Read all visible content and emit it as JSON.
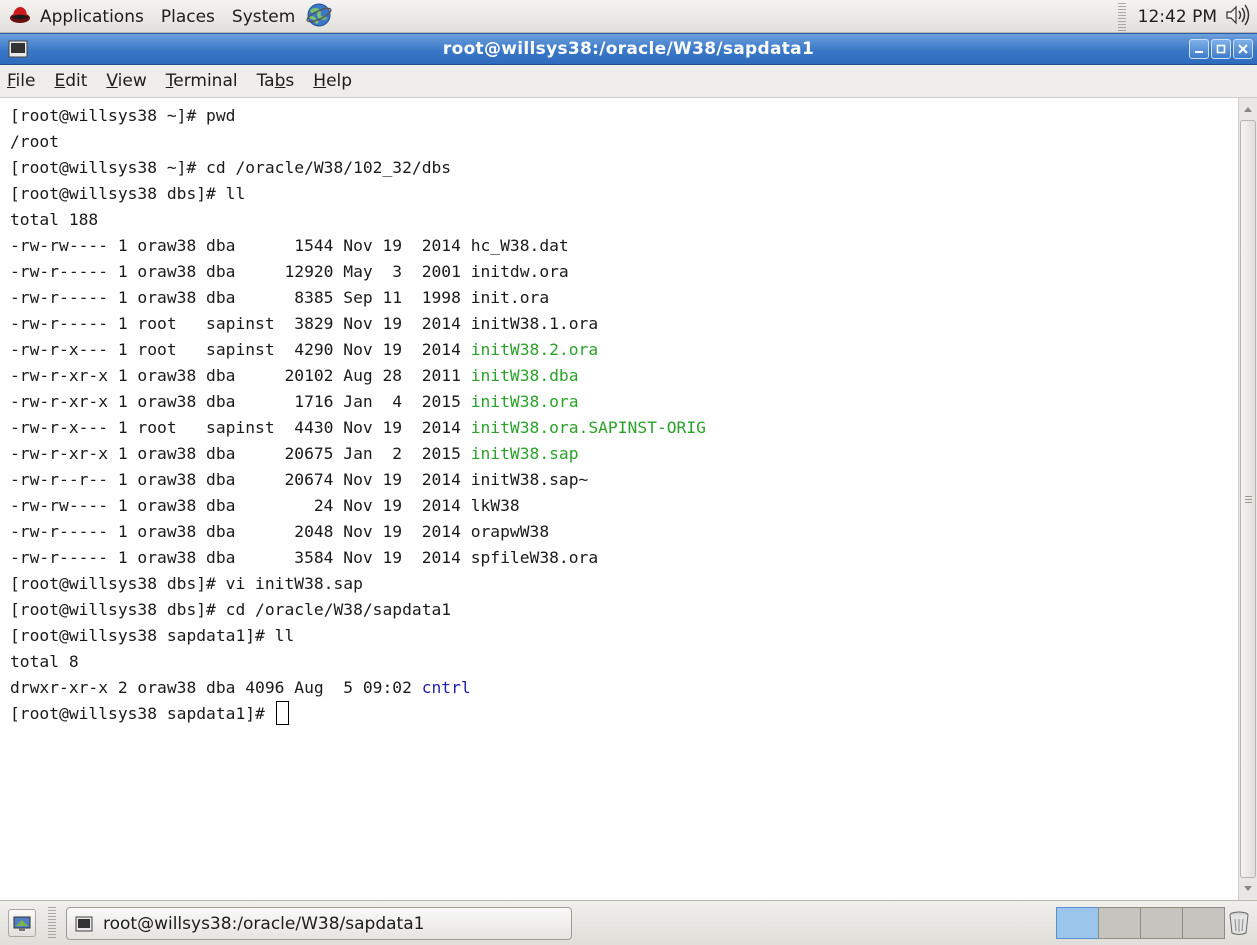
{
  "top_panel": {
    "menus": [
      "Applications",
      "Places",
      "System"
    ],
    "clock": "12:42 PM"
  },
  "window": {
    "title": "root@willsys38:/oracle/W38/sapdata1"
  },
  "menubar": [
    {
      "label": "File",
      "mnemonic": "F",
      "rest": "ile"
    },
    {
      "label": "Edit",
      "mnemonic": "E",
      "rest": "dit"
    },
    {
      "label": "View",
      "mnemonic": "V",
      "rest": "iew"
    },
    {
      "label": "Terminal",
      "mnemonic": "T",
      "rest": "erminal"
    },
    {
      "label": "Tabs",
      "pre": "Ta",
      "mnemonic": "b",
      "rest": "s"
    },
    {
      "label": "Help",
      "mnemonic": "H",
      "rest": "elp"
    }
  ],
  "terminal": {
    "lines": [
      {
        "text": "[root@willsys38 ~]# pwd"
      },
      {
        "text": "/root"
      },
      {
        "text": "[root@willsys38 ~]# cd /oracle/W38/102_32/dbs"
      },
      {
        "text": "[root@willsys38 dbs]# ll"
      },
      {
        "text": "total 188"
      },
      {
        "text": "-rw-rw---- 1 oraw38 dba      1544 Nov 19  2014 ",
        "name": "hc_W38.dat"
      },
      {
        "text": "-rw-r----- 1 oraw38 dba     12920 May  3  2001 ",
        "name": "initdw.ora"
      },
      {
        "text": "-rw-r----- 1 oraw38 dba      8385 Sep 11  1998 ",
        "name": "init.ora"
      },
      {
        "text": "-rw-r----- 1 root   sapinst  3829 Nov 19  2014 ",
        "name": "initW38.1.ora"
      },
      {
        "text": "-rw-r-x--- 1 root   sapinst  4290 Nov 19  2014 ",
        "name": "initW38.2.ora",
        "color": "green"
      },
      {
        "text": "-rw-r-xr-x 1 oraw38 dba     20102 Aug 28  2011 ",
        "name": "initW38.dba",
        "color": "green"
      },
      {
        "text": "-rw-r-xr-x 1 oraw38 dba      1716 Jan  4  2015 ",
        "name": "initW38.ora",
        "color": "green"
      },
      {
        "text": "-rw-r-x--- 1 root   sapinst  4430 Nov 19  2014 ",
        "name": "initW38.ora.SAPINST-ORIG",
        "color": "green"
      },
      {
        "text": "-rw-r-xr-x 1 oraw38 dba     20675 Jan  2  2015 ",
        "name": "initW38.sap",
        "color": "green"
      },
      {
        "text": "-rw-r--r-- 1 oraw38 dba     20674 Nov 19  2014 ",
        "name": "initW38.sap~"
      },
      {
        "text": "-rw-rw---- 1 oraw38 dba        24 Nov 19  2014 ",
        "name": "lkW38"
      },
      {
        "text": "-rw-r----- 1 oraw38 dba      2048 Nov 19  2014 ",
        "name": "orapwW38"
      },
      {
        "text": "-rw-r----- 1 oraw38 dba      3584 Nov 19  2014 ",
        "name": "spfileW38.ora"
      },
      {
        "text": "[root@willsys38 dbs]# vi initW38.sap"
      },
      {
        "text": "[root@willsys38 dbs]# cd /oracle/W38/sapdata1"
      },
      {
        "text": "[root@willsys38 sapdata1]# ll"
      },
      {
        "text": "total 8"
      },
      {
        "text": "drwxr-xr-x 2 oraw38 dba 4096 Aug  5 09:02 ",
        "name": "cntrl",
        "color": "blue"
      },
      {
        "text": "[root@willsys38 sapdata1]# ",
        "cursor": true
      }
    ]
  },
  "taskbar": {
    "task_label": "root@willsys38:/oracle/W38/sapdata1",
    "workspaces": 4,
    "active_workspace": 1
  },
  "colors": {
    "titlebar": "#3a78c7",
    "exec_file": "#2aa22a",
    "directory": "#2222aa"
  }
}
